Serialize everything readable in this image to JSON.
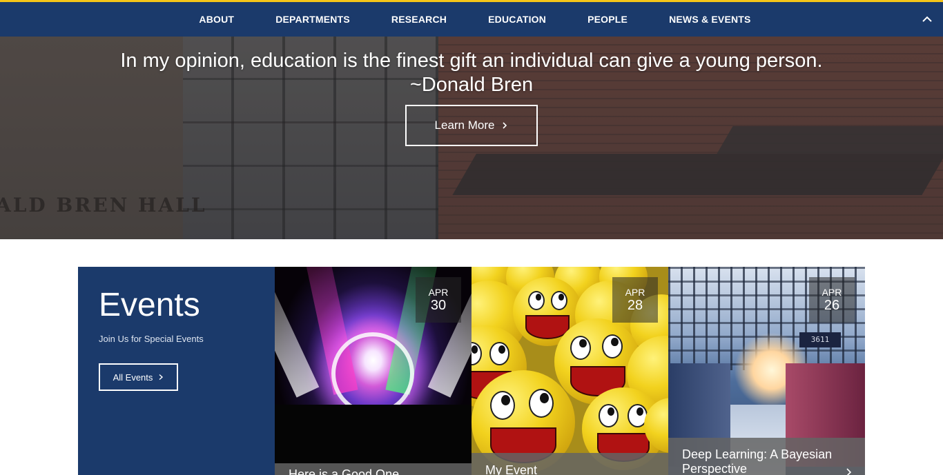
{
  "nav": {
    "items": [
      {
        "label": "ABOUT"
      },
      {
        "label": "DEPARTMENTS"
      },
      {
        "label": "RESEARCH"
      },
      {
        "label": "EDUCATION"
      },
      {
        "label": "PEOPLE"
      },
      {
        "label": "NEWS & EVENTS"
      }
    ],
    "collapse_icon": "chevron-up-icon",
    "accent_color": "#f5c518",
    "background_color": "#1b3a6b"
  },
  "hero": {
    "quote_line1": "In my opinion, education is the finest gift an individual can give a young person.",
    "quote_line2": "~Donald Bren",
    "button_label": "Learn More",
    "button_icon": "chevron-right-icon",
    "building_sign": "ALD BREN HALL"
  },
  "events": {
    "title": "Events",
    "subtitle": "Join Us for Special Events",
    "all_button_label": "All Events",
    "all_button_icon": "chevron-right-icon",
    "cards": [
      {
        "month": "APR",
        "day": "30",
        "title": "Here is a Good One",
        "image": "concert-lights-image"
      },
      {
        "month": "APR",
        "day": "28",
        "title": "My Event",
        "image": "smiley-faces-image"
      },
      {
        "month": "APR",
        "day": "26",
        "title": "Deep Learning: A Bayesian Perspective",
        "image": "train-station-image",
        "sign_text": "3611"
      }
    ]
  }
}
